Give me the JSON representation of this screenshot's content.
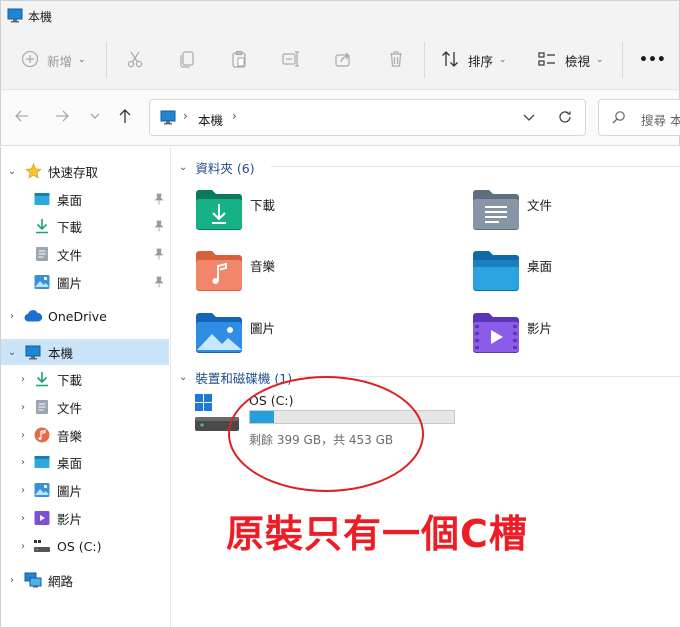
{
  "window": {
    "title": "本機"
  },
  "toolbar": {
    "new_label": "新增",
    "sort_label": "排序",
    "view_label": "檢視",
    "more_label": "•••"
  },
  "address": {
    "path": [
      "本機"
    ],
    "search_placeholder": "搜尋 本"
  },
  "sidebar": {
    "quick_access": {
      "label": "快速存取",
      "items": [
        {
          "label": "桌面",
          "icon": "desktop-icon"
        },
        {
          "label": "下載",
          "icon": "download-icon"
        },
        {
          "label": "文件",
          "icon": "document-icon"
        },
        {
          "label": "圖片",
          "icon": "pictures-icon"
        }
      ]
    },
    "onedrive": {
      "label": "OneDrive"
    },
    "this_pc": {
      "label": "本機",
      "items": [
        {
          "label": "下載"
        },
        {
          "label": "文件"
        },
        {
          "label": "音樂"
        },
        {
          "label": "桌面"
        },
        {
          "label": "圖片"
        },
        {
          "label": "影片"
        },
        {
          "label": "OS (C:)"
        }
      ]
    },
    "network": {
      "label": "網路"
    }
  },
  "main": {
    "folders_header": "資料夾 (6)",
    "folders": [
      {
        "label": "下載",
        "icon": "downloads-folder-icon"
      },
      {
        "label": "文件",
        "icon": "documents-folder-icon"
      },
      {
        "label": "音樂",
        "icon": "music-folder-icon"
      },
      {
        "label": "桌面",
        "icon": "desktop-folder-icon"
      },
      {
        "label": "圖片",
        "icon": "pictures-folder-icon"
      },
      {
        "label": "影片",
        "icon": "videos-folder-icon"
      }
    ],
    "devices_header": "裝置和磁碟機 (1)",
    "drive": {
      "name": "OS (C:)",
      "space": "剩餘 399 GB，共 453 GB",
      "used_fraction": 0.119
    }
  },
  "annotation": {
    "text": "原裝只有一個C槽"
  },
  "colors": {
    "selection": "#cce4f7",
    "drive_bar": "#26a0da",
    "annotation": "#ee1c25",
    "group_header": "#1e4e8c"
  }
}
